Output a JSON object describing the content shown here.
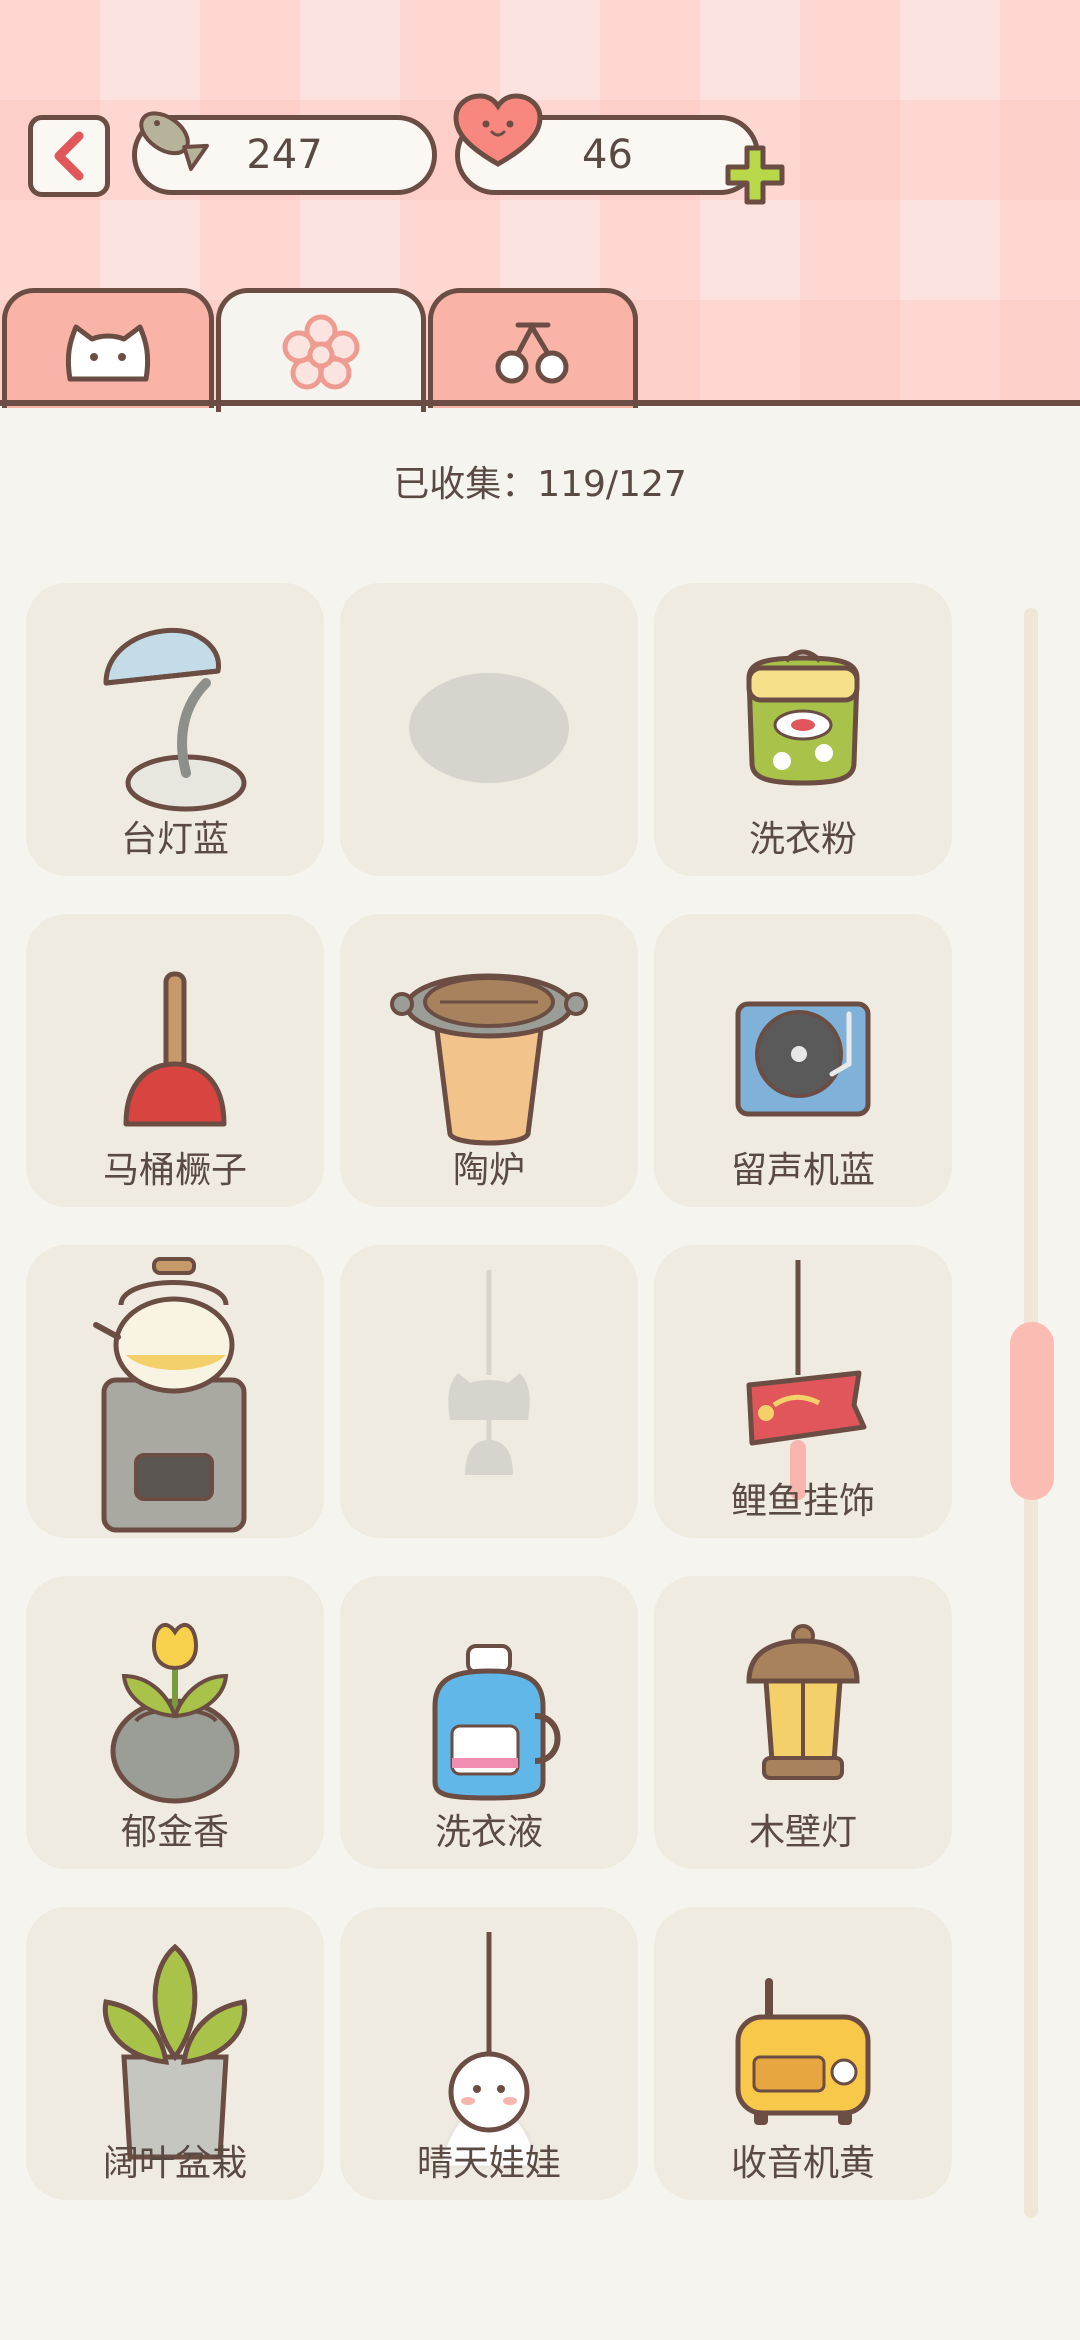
{
  "header": {
    "fish_count": "247",
    "heart_count": "46",
    "colors": {
      "accent": "#f9b3a7",
      "outline": "#6b4d44",
      "plus": "#b8d84a"
    }
  },
  "tabs": [
    {
      "icon": "cat-face-icon",
      "active": false
    },
    {
      "icon": "flower-icon",
      "active": true
    },
    {
      "icon": "cherry-icon",
      "active": false
    }
  ],
  "collected_text": "已收集：119/127",
  "items": [
    {
      "label": "台灯蓝",
      "icon": "desk-lamp-blue-icon",
      "locked": false
    },
    {
      "label": "",
      "icon": "locked-item-silhouette",
      "locked": true
    },
    {
      "label": "洗衣粉",
      "icon": "laundry-powder-icon",
      "locked": false
    },
    {
      "label": "马桶橛子",
      "icon": "plunger-icon",
      "locked": false
    },
    {
      "label": "陶炉",
      "icon": "clay-stove-icon",
      "locked": false
    },
    {
      "label": "留声机蓝",
      "icon": "record-player-blue-icon",
      "locked": false
    },
    {
      "label": "",
      "icon": "kettle-stove-icon",
      "locked": false
    },
    {
      "label": "",
      "icon": "locked-wind-chime-silhouette",
      "locked": true
    },
    {
      "label": "鲤鱼挂饰",
      "icon": "koi-streamer-icon",
      "locked": false
    },
    {
      "label": "郁金香",
      "icon": "tulip-pot-icon",
      "locked": false
    },
    {
      "label": "洗衣液",
      "icon": "laundry-detergent-icon",
      "locked": false
    },
    {
      "label": "木壁灯",
      "icon": "wooden-wall-lamp-icon",
      "locked": false
    },
    {
      "label": "阔叶盆栽",
      "icon": "broadleaf-plant-icon",
      "locked": false
    },
    {
      "label": "晴天娃娃",
      "icon": "teru-teru-bozu-icon",
      "locked": false
    },
    {
      "label": "收音机黄",
      "icon": "radio-yellow-icon",
      "locked": false
    }
  ]
}
